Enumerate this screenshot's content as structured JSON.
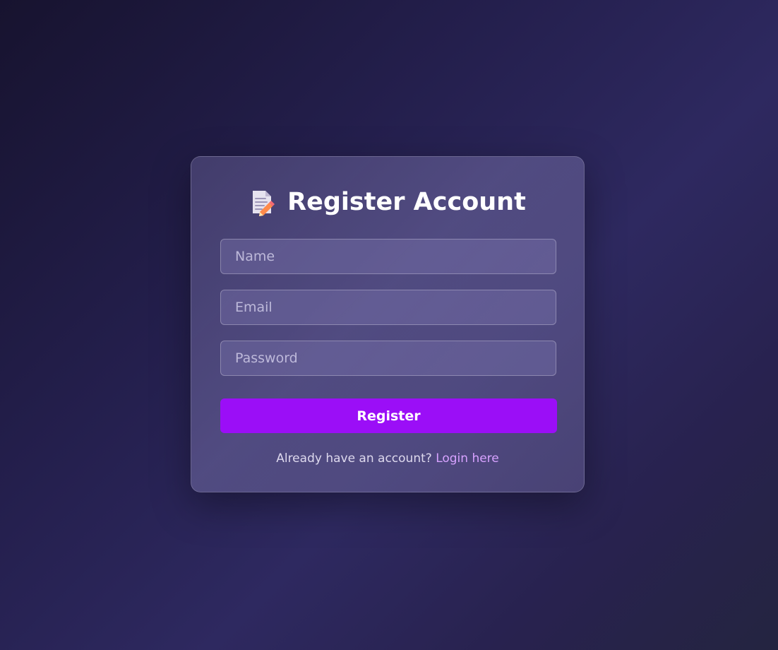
{
  "card": {
    "icon": "memo-pencil-icon",
    "title": "Register Account"
  },
  "form": {
    "name_placeholder": "Name",
    "email_placeholder": "Email",
    "password_placeholder": "Password",
    "register_label": "Register"
  },
  "footer": {
    "prompt": "Already have an account? ",
    "login_link": "Login here"
  },
  "colors": {
    "primary": "#9b0ef7",
    "link": "#d7a2ff"
  }
}
